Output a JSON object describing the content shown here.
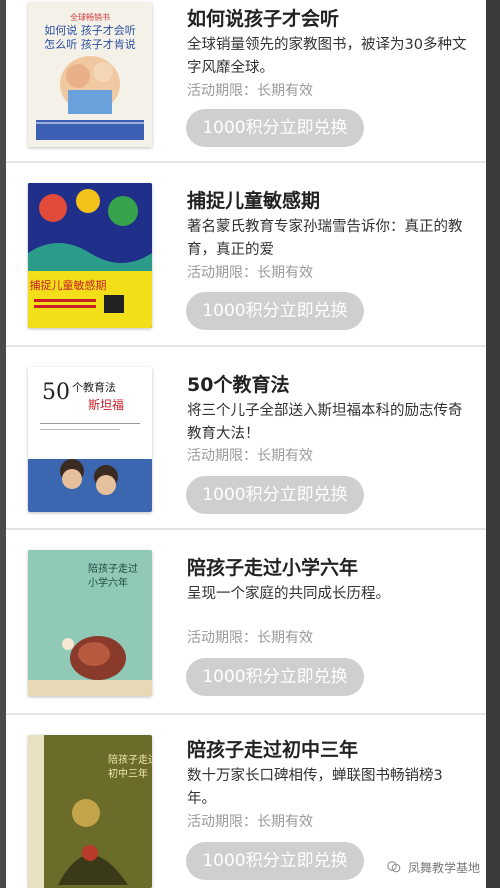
{
  "items": [
    {
      "title": "如何说孩子才会听",
      "desc": "全球销量领先的家教图书，被译为30多种文字风靡全球。",
      "period": "活动期限：长期有效",
      "button": "1000积分立即兑换",
      "cover": {
        "text": "如何说 孩子才会听 怎么听 孩子才肯说",
        "colors": [
          "#f4f1e8",
          "#3b5fb3"
        ]
      }
    },
    {
      "title": "捕捉儿童敏感期",
      "desc": "著名蒙氏教育专家孙瑞雪告诉你：真正的教育，真正的爱",
      "period": "活动期限：长期有效",
      "button": "1000积分立即兑换",
      "cover": {
        "text": "捕捉儿童敏感期",
        "colors": [
          "#1f2f8a",
          "#f2df1a"
        ]
      }
    },
    {
      "title": "50个教育法",
      "desc": "将三个儿子全部送入斯坦福本科的励志传奇教育大法！",
      "period": "活动期限：长期有效",
      "button": "1000积分立即兑换",
      "cover": {
        "text": "50个教育法",
        "colors": [
          "#ffffff",
          "#3a67b0"
        ]
      }
    },
    {
      "title": "陪孩子走过小学六年",
      "desc": "呈现一个家庭的共同成长历程。",
      "period": "活动期限：长期有效",
      "button": "1000积分立即兑换",
      "cover": {
        "text": "陪孩子走过小学六年",
        "colors": [
          "#5dbcae",
          "#f1e4c6"
        ]
      }
    },
    {
      "title": "陪孩子走过初中三年",
      "desc": "数十万家长口碑相传，蝉联图书畅销榜3年。",
      "period": "活动期限：长期有效",
      "button": "1000积分立即兑换",
      "cover": {
        "text": "陪孩子走过初中三年",
        "colors": [
          "#6b6b2a",
          "#e9e2c2"
        ]
      }
    }
  ],
  "watermark": "凤舞教学基地"
}
